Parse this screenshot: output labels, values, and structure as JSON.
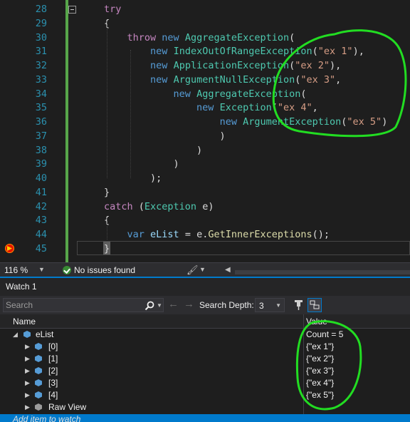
{
  "editor": {
    "lines": [
      {
        "num": "28",
        "tokens": [
          [
            "kw",
            "try"
          ]
        ]
      },
      {
        "num": "29",
        "tokens": [
          [
            "",
            "{"
          ]
        ]
      },
      {
        "num": "30",
        "tokens": [
          [
            "",
            "    "
          ],
          [
            "kw",
            "throw"
          ],
          [
            "",
            " "
          ],
          [
            "kb",
            "new"
          ],
          [
            "",
            " "
          ],
          [
            "ty",
            "AggregateException"
          ],
          [
            "",
            "("
          ]
        ]
      },
      {
        "num": "31",
        "tokens": [
          [
            "",
            "        "
          ],
          [
            "kb",
            "new"
          ],
          [
            "",
            " "
          ],
          [
            "ty",
            "IndexOutOfRangeException"
          ],
          [
            "",
            "("
          ],
          [
            "st",
            "\"ex 1\""
          ],
          [
            "",
            "),"
          ]
        ]
      },
      {
        "num": "32",
        "tokens": [
          [
            "",
            "        "
          ],
          [
            "kb",
            "new"
          ],
          [
            "",
            " "
          ],
          [
            "ty",
            "ApplicationException"
          ],
          [
            "",
            "("
          ],
          [
            "st",
            "\"ex 2\""
          ],
          [
            "",
            "),"
          ]
        ]
      },
      {
        "num": "33",
        "tokens": [
          [
            "",
            "        "
          ],
          [
            "kb",
            "new"
          ],
          [
            "",
            " "
          ],
          [
            "ty",
            "ArgumentNullException"
          ],
          [
            "",
            "("
          ],
          [
            "st",
            "\"ex 3\""
          ],
          [
            "",
            ","
          ]
        ]
      },
      {
        "num": "34",
        "tokens": [
          [
            "",
            "            "
          ],
          [
            "kb",
            "new"
          ],
          [
            "",
            " "
          ],
          [
            "ty",
            "AggregateException"
          ],
          [
            "",
            "("
          ]
        ]
      },
      {
        "num": "35",
        "tokens": [
          [
            "",
            "                "
          ],
          [
            "kb",
            "new"
          ],
          [
            "",
            " "
          ],
          [
            "ty",
            "Exception"
          ],
          [
            "",
            "("
          ],
          [
            "st",
            "\"ex 4\""
          ],
          [
            "",
            ","
          ]
        ]
      },
      {
        "num": "36",
        "tokens": [
          [
            "",
            "                    "
          ],
          [
            "kb",
            "new"
          ],
          [
            "",
            " "
          ],
          [
            "ty",
            "ArgumentException"
          ],
          [
            "",
            "("
          ],
          [
            "st",
            "\"ex 5\""
          ],
          [
            "",
            ")"
          ]
        ]
      },
      {
        "num": "37",
        "tokens": [
          [
            "",
            "                    )"
          ]
        ]
      },
      {
        "num": "38",
        "tokens": [
          [
            "",
            "                )"
          ]
        ]
      },
      {
        "num": "39",
        "tokens": [
          [
            "",
            "            )"
          ]
        ]
      },
      {
        "num": "40",
        "tokens": [
          [
            "",
            "        );"
          ]
        ]
      },
      {
        "num": "41",
        "tokens": [
          [
            "",
            "}"
          ]
        ]
      },
      {
        "num": "42",
        "tokens": [
          [
            "kw",
            "catch"
          ],
          [
            "",
            " ("
          ],
          [
            "ty",
            "Exception"
          ],
          [
            "",
            " e)"
          ]
        ]
      },
      {
        "num": "43",
        "tokens": [
          [
            "",
            "{"
          ]
        ]
      },
      {
        "num": "44",
        "tokens": [
          [
            "",
            "    "
          ],
          [
            "kb",
            "var"
          ],
          [
            "",
            " "
          ],
          [
            "id",
            "eList"
          ],
          [
            "",
            " = e."
          ],
          [
            "fn",
            "GetInnerExceptions"
          ],
          [
            "",
            "();"
          ]
        ]
      },
      {
        "num": "45",
        "tokens": [
          [
            "",
            "}"
          ]
        ]
      }
    ]
  },
  "status": {
    "zoom": "116 %",
    "issues": "No issues found"
  },
  "watch": {
    "title": "Watch 1",
    "search_placeholder": "Search",
    "depth_label": "Search Depth:",
    "depth_value": "3",
    "col_name": "Name",
    "col_value": "Value",
    "rows": [
      {
        "name": "eList",
        "value": "Count = 5"
      },
      {
        "name": "[0]",
        "value": "{\"ex 1\"}"
      },
      {
        "name": "[1]",
        "value": "{\"ex 2\"}"
      },
      {
        "name": "[2]",
        "value": "{\"ex 3\"}"
      },
      {
        "name": "[3]",
        "value": "{\"ex 4\"}"
      },
      {
        "name": "[4]",
        "value": "{\"ex 5\"}"
      },
      {
        "name": "Raw View",
        "value": ""
      }
    ],
    "add_item": "Add item to watch"
  },
  "colors": {
    "accent": "#007acc",
    "annotation": "#22dd22"
  }
}
